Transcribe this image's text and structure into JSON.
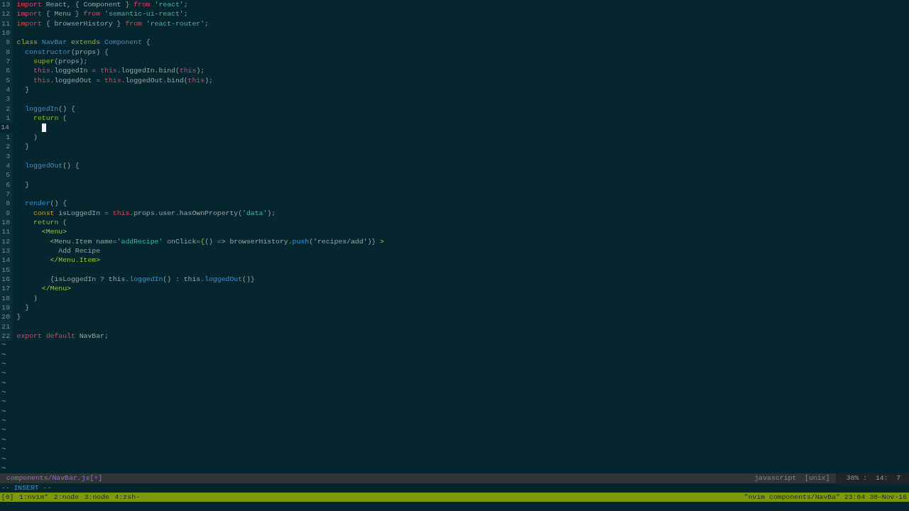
{
  "editor": {
    "lines": [
      {
        "number": "13",
        "current": false,
        "tokens": [
          {
            "text": "import",
            "kind": "kw"
          },
          {
            "text": " React, { Component } ",
            "kind": "plain"
          },
          {
            "text": "from",
            "kind": "kw"
          },
          {
            "text": " 'react'",
            "kind": "str"
          },
          {
            "text": ";",
            "kind": "plain"
          }
        ]
      },
      {
        "number": "12",
        "current": false,
        "tokens": [
          {
            "text": "import",
            "kind": "kw"
          },
          {
            "text": " { Menu } ",
            "kind": "plain"
          },
          {
            "text": "from",
            "kind": "kw"
          },
          {
            "text": " 'semantic-ui-react'",
            "kind": "str"
          },
          {
            "text": ";",
            "kind": "plain"
          }
        ]
      },
      {
        "number": "11",
        "current": false,
        "tokens": [
          {
            "text": "import",
            "kind": "kw"
          },
          {
            "text": " { browserHistory } ",
            "kind": "plain"
          },
          {
            "text": "from",
            "kind": "kw"
          },
          {
            "text": " 'react-router'",
            "kind": "str"
          },
          {
            "text": ";",
            "kind": "plain"
          }
        ]
      },
      {
        "number": "10",
        "current": false
      },
      {
        "number": "9",
        "current": false,
        "tokens": [
          {
            "text": "class",
            "kind": "cls"
          },
          {
            "text": " NavBar",
            "kind": "type"
          },
          {
            "text": " extends",
            "kind": "cls"
          },
          {
            "text": " Component",
            "kind": "type"
          },
          {
            "text": " {",
            "kind": "plain"
          }
        ]
      },
      {
        "number": "8",
        "current": false,
        "tokens": [
          {
            "text": "  constructor",
            "kind": "type"
          },
          {
            "text": "(props) {",
            "kind": "plain"
          }
        ]
      },
      {
        "number": "7",
        "current": false,
        "tokens": [
          {
            "text": "    super",
            "kind": "cls"
          },
          {
            "text": "(props);",
            "kind": "plain"
          }
        ]
      },
      {
        "number": "6",
        "current": false,
        "tokens": [
          {
            "text": "    this",
            "kind": "kw"
          },
          {
            "text": ".loggedIn = ",
            "kind": "plain"
          },
          {
            "text": "this",
            "kind": "kw"
          },
          {
            "text": ".loggedIn.bind(",
            "kind": "plain"
          },
          {
            "text": "this",
            "kind": "kw"
          },
          {
            "text": ");",
            "kind": "plain"
          }
        ]
      },
      {
        "number": "5",
        "current": false,
        "tokens": [
          {
            "text": "    this",
            "kind": "kw"
          },
          {
            "text": ".loggedOut = ",
            "kind": "plain"
          },
          {
            "text": "this",
            "kind": "kw"
          },
          {
            "text": ".loggedOut.bind(",
            "kind": "plain"
          },
          {
            "text": "this",
            "kind": "kw"
          },
          {
            "text": ");",
            "kind": "plain"
          }
        ]
      },
      {
        "number": "4",
        "current": false,
        "tokens": [
          {
            "text": "  }",
            "kind": "plain"
          }
        ]
      },
      {
        "number": "3",
        "current": false
      },
      {
        "number": "2",
        "current": false,
        "tokens": [
          {
            "text": "  loggedIn",
            "kind": "type"
          },
          {
            "text": "() {",
            "kind": "plain"
          }
        ]
      },
      {
        "number": "1",
        "current": false,
        "tokens": [
          {
            "text": "    return",
            "kind": "cls"
          },
          {
            "text": " (",
            "kind": "plain"
          }
        ]
      },
      {
        "number": "14",
        "current": true,
        "cursor": true
      },
      {
        "number": "1",
        "current": false,
        "tokens": [
          {
            "text": "    )",
            "kind": "plain"
          }
        ]
      },
      {
        "number": "2",
        "current": false,
        "tokens": [
          {
            "text": "  }",
            "kind": "plain"
          }
        ]
      },
      {
        "number": "3",
        "current": false
      },
      {
        "number": "4",
        "current": false,
        "tokens": [
          {
            "text": "  loggedOut",
            "kind": "type"
          },
          {
            "text": "() {",
            "kind": "plain"
          }
        ]
      },
      {
        "number": "5",
        "current": false
      },
      {
        "number": "6",
        "current": false,
        "tokens": [
          {
            "text": "  }",
            "kind": "plain"
          }
        ]
      },
      {
        "number": "7",
        "current": false
      },
      {
        "number": "8",
        "current": false,
        "tokens": [
          {
            "text": "  render",
            "kind": "type"
          },
          {
            "text": "() {",
            "kind": "plain"
          }
        ]
      },
      {
        "number": "9",
        "current": false,
        "tokens": [
          {
            "text": "    const",
            "kind": "const"
          },
          {
            "text": " isLoggedIn ",
            "kind": "plain"
          },
          {
            "text": "=",
            "kind": "const"
          },
          {
            "text": " this",
            "kind": "kw"
          },
          {
            "text": ".props.user.hasOwnProperty(",
            "kind": "plain"
          },
          {
            "text": "'data'",
            "kind": "str"
          },
          {
            "text": ");",
            "kind": "plain"
          }
        ]
      },
      {
        "number": "10",
        "current": false,
        "tokens": [
          {
            "text": "    return",
            "kind": "cls"
          },
          {
            "text": " (",
            "kind": "plain"
          }
        ]
      },
      {
        "number": "11",
        "current": false,
        "tokens": [
          {
            "text": "      <Menu>",
            "kind": "tag"
          }
        ]
      },
      {
        "number": "12",
        "current": false,
        "tokens": [
          {
            "text": "        <",
            "kind": "tag"
          },
          {
            "text": "Menu.Item name",
            "kind": "plain"
          },
          {
            "text": "=",
            "kind": "const"
          },
          {
            "text": "'addRecipe'",
            "kind": "str"
          },
          {
            "text": " onClick",
            "kind": "plain"
          },
          {
            "text": "={",
            "kind": "tag"
          },
          {
            "text": "() => browserHistory.",
            "kind": "plain"
          },
          {
            "text": "push",
            "kind": "type"
          },
          {
            "text": "('recipes/add')} ",
            "kind": "plain"
          },
          {
            "text": ">",
            "kind": "tag"
          }
        ]
      },
      {
        "number": "13",
        "current": false,
        "tokens": [
          {
            "text": "          Add Recipe",
            "kind": "plain"
          }
        ]
      },
      {
        "number": "14",
        "current": false,
        "tokens": [
          {
            "text": "        </Menu.Item>",
            "kind": "tag"
          }
        ]
      },
      {
        "number": "15",
        "current": false
      },
      {
        "number": "16",
        "current": false,
        "tokens": [
          {
            "text": "        {isLoggedIn ? this.",
            "kind": "plain"
          },
          {
            "text": "loggedIn",
            "kind": "type"
          },
          {
            "text": "() : this.",
            "kind": "plain"
          },
          {
            "text": "loggedOut",
            "kind": "type"
          },
          {
            "text": "()}",
            "kind": "plain"
          }
        ]
      },
      {
        "number": "17",
        "current": false,
        "tokens": [
          {
            "text": "      </Menu>",
            "kind": "tag"
          }
        ]
      },
      {
        "number": "18",
        "current": false,
        "tokens": [
          {
            "text": "    )",
            "kind": "plain"
          }
        ]
      },
      {
        "number": "19",
        "current": false,
        "tokens": [
          {
            "text": "  }",
            "kind": "plain"
          }
        ]
      },
      {
        "number": "20",
        "current": false,
        "tokens": [
          {
            "text": "}",
            "kind": "plain"
          }
        ]
      },
      {
        "number": "21",
        "current": false
      },
      {
        "number": "22",
        "current": false,
        "tokens": [
          {
            "text": "export",
            "kind": "kw"
          },
          {
            "text": " default",
            "kind": "kw"
          },
          {
            "text": " NavBar;",
            "kind": "plain"
          }
        ]
      }
    ],
    "filler": [
      "~",
      "~",
      "~",
      "~",
      "~",
      "~",
      "~",
      "~",
      "~",
      "~",
      "~",
      "~",
      "~",
      "~"
    ]
  },
  "status_line": {
    "file": "components/NavBar.js[+]",
    "filetype": "javascript",
    "format": "[unix]",
    "position": "38% :  14:  7"
  },
  "mode": "-- INSERT --",
  "tmux_bar": {
    "session": "[0]",
    "windows": [
      "1:nvim*",
      "2:node",
      "3:node",
      "4:zsh-"
    ],
    "right": "\"nvim components/NavBa\" 23:04 30-Nov-16"
  }
}
